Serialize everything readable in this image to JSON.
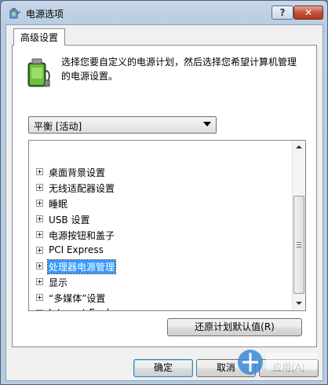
{
  "window": {
    "title": "电源选项",
    "help_label": "?",
    "close_label": "✕",
    "icon": "power-options-icon"
  },
  "tab": {
    "label": "高级设置"
  },
  "description": "选择您要自定义的电源计划，然后选择您希望计算机管理的电源设置。",
  "plan_select": {
    "value": "平衡 [活动]"
  },
  "tree": {
    "items": [
      {
        "label": "桌面背景设置",
        "selected": false
      },
      {
        "label": "无线适配器设置",
        "selected": false
      },
      {
        "label": "睡眠",
        "selected": false
      },
      {
        "label": "USB 设置",
        "selected": false
      },
      {
        "label": "电源按钮和盖子",
        "selected": false
      },
      {
        "label": "PCI Express",
        "selected": false
      },
      {
        "label": "处理器电源管理",
        "selected": true
      },
      {
        "label": "显示",
        "selected": false
      },
      {
        "label": "“多媒体”设置",
        "selected": false
      },
      {
        "label": "Internet Explorer",
        "selected": false
      }
    ]
  },
  "buttons": {
    "restore": "还原计划默认值(R)",
    "ok": "确定",
    "cancel": "取消",
    "apply": "应用(A)"
  },
  "colors": {
    "selection": "#3399ff",
    "title_bar": "#c8d7e8",
    "close_button": "#c4503a"
  }
}
